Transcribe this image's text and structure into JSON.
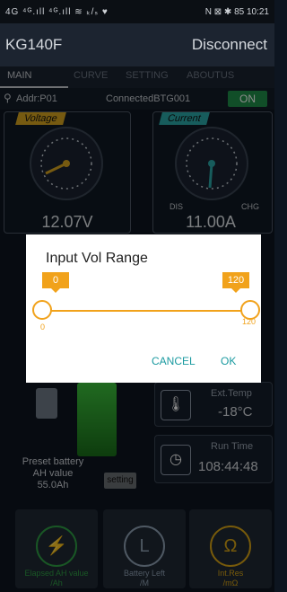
{
  "status_bar": {
    "left": "4G ⁴ᴳ.ıll ⁴ᴳ.ıll ≋ ₖ/ₛ ♥",
    "right": "N ⊠ ✱ 85 10:21"
  },
  "app": {
    "title": "KG140F",
    "disconnect": "Disconnect"
  },
  "tabs": [
    {
      "label": "MAIN"
    },
    {
      "label": "CURVE"
    },
    {
      "label": "SETTING"
    },
    {
      "label": "ABOUTUS"
    }
  ],
  "addr_row": {
    "addr": "Addr:P01",
    "connected": "ConnectedBTG001",
    "on_label": "ON"
  },
  "gauges": [
    {
      "label": "Voltage",
      "value": "12.07V",
      "ticks": [
        "0",
        "12",
        "24",
        "36",
        "48",
        "60",
        "72",
        "84",
        "96",
        "108",
        "120"
      ]
    },
    {
      "label": "Current",
      "value": "11.00A",
      "dis": "DIS",
      "chg": "CHG"
    }
  ],
  "side_panels": [
    {
      "name": "Ext.Temp",
      "value": "-18°C"
    },
    {
      "name": "Run Time",
      "value": "108:44:48"
    }
  ],
  "battery": {
    "preset_label_1": "Preset battery",
    "preset_label_2": "AH value",
    "preset_value": "55.0Ah",
    "setting_button": "setting"
  },
  "bottom_cards": [
    {
      "label_1": "Elapsed AH value",
      "label_2": "/Ah",
      "color": "#2f9e44"
    },
    {
      "label_1": "Battery Left",
      "label_2": "/M",
      "color": "#8fa0b3"
    },
    {
      "label_1": "Int.Res",
      "label_2": "/mΩ",
      "color": "#d9a514"
    }
  ],
  "dialog": {
    "title": "Input Vol Range",
    "min_value": "0",
    "max_value": "120",
    "range_min_label": "0",
    "range_max_label": "120",
    "cancel": "CANCEL",
    "ok": "OK",
    "low_fraction": 0.0,
    "high_fraction": 1.0
  },
  "colors": {
    "accent": "#f1a21b",
    "ok_button": "#1a9aa0",
    "on_green": "#1f8f4a",
    "voltage_badge": "#d7a51f",
    "current_badge": "#2aa8a8"
  }
}
